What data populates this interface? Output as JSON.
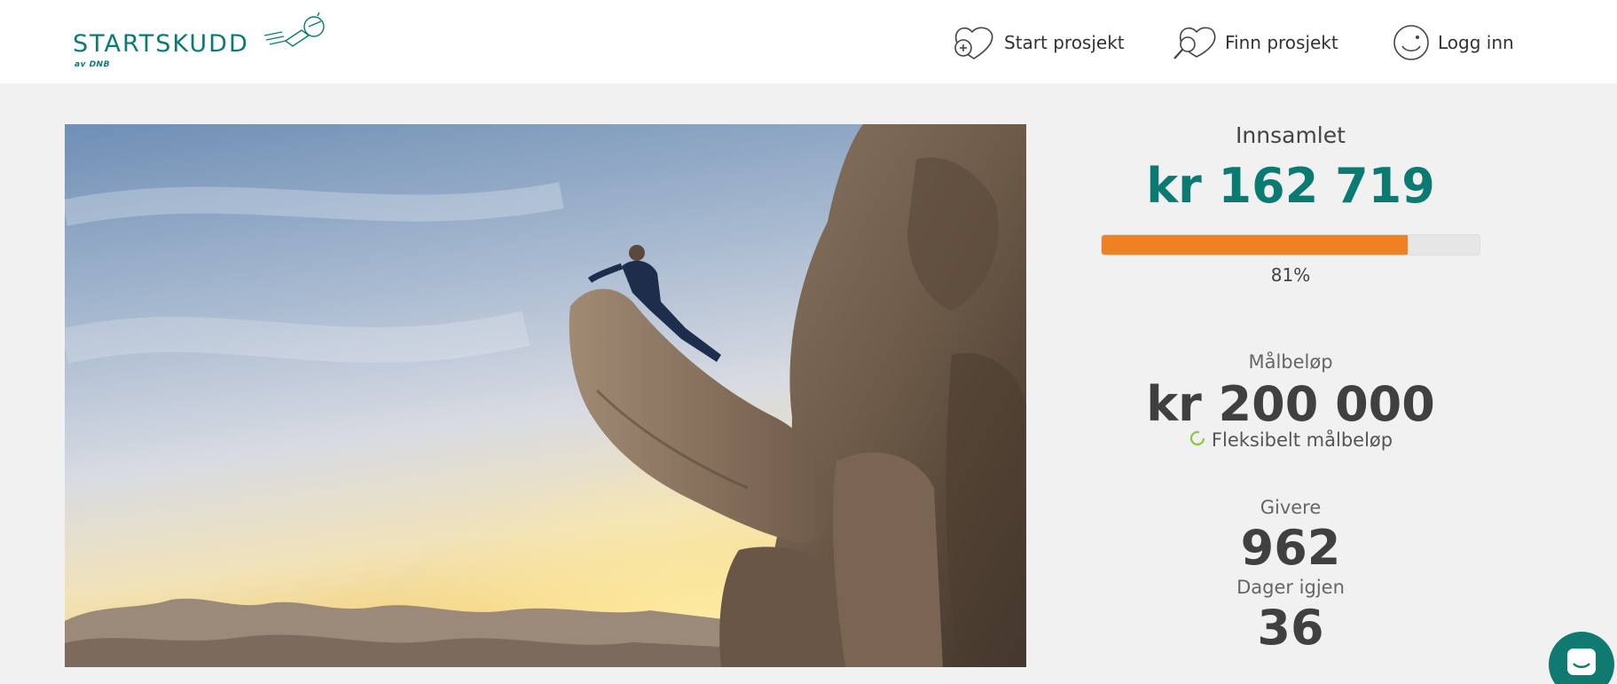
{
  "header": {
    "logo": {
      "brand": "STARTSKUDD",
      "sub": "av DNB",
      "icon": "rocket-icon"
    },
    "nav": [
      {
        "label": "Start prosjekt",
        "icon": "heart-plus-icon"
      },
      {
        "label": "Finn prosjekt",
        "icon": "heart-magnifier-icon"
      },
      {
        "label": "Logg inn",
        "icon": "smiley-icon"
      }
    ]
  },
  "hero": {
    "alt_icon": "project-photo"
  },
  "stats": {
    "raised_label": "Innsamlet",
    "raised_value": "kr 162 719",
    "progress_fraction": 0.81,
    "progress_text": "81%",
    "goal_label": "Målbeløp",
    "goal_value": "kr 200 000",
    "flexible_label": "Fleksibelt målbeløp",
    "givers_label": "Givere",
    "givers_value": "962",
    "days_label": "Dager igjen",
    "days_value": "36"
  },
  "chat": {
    "icon": "chat-icon"
  },
  "colors": {
    "brand": "#0b7a73",
    "progress": "#f08024",
    "flex_ring": "#8cc63f"
  }
}
